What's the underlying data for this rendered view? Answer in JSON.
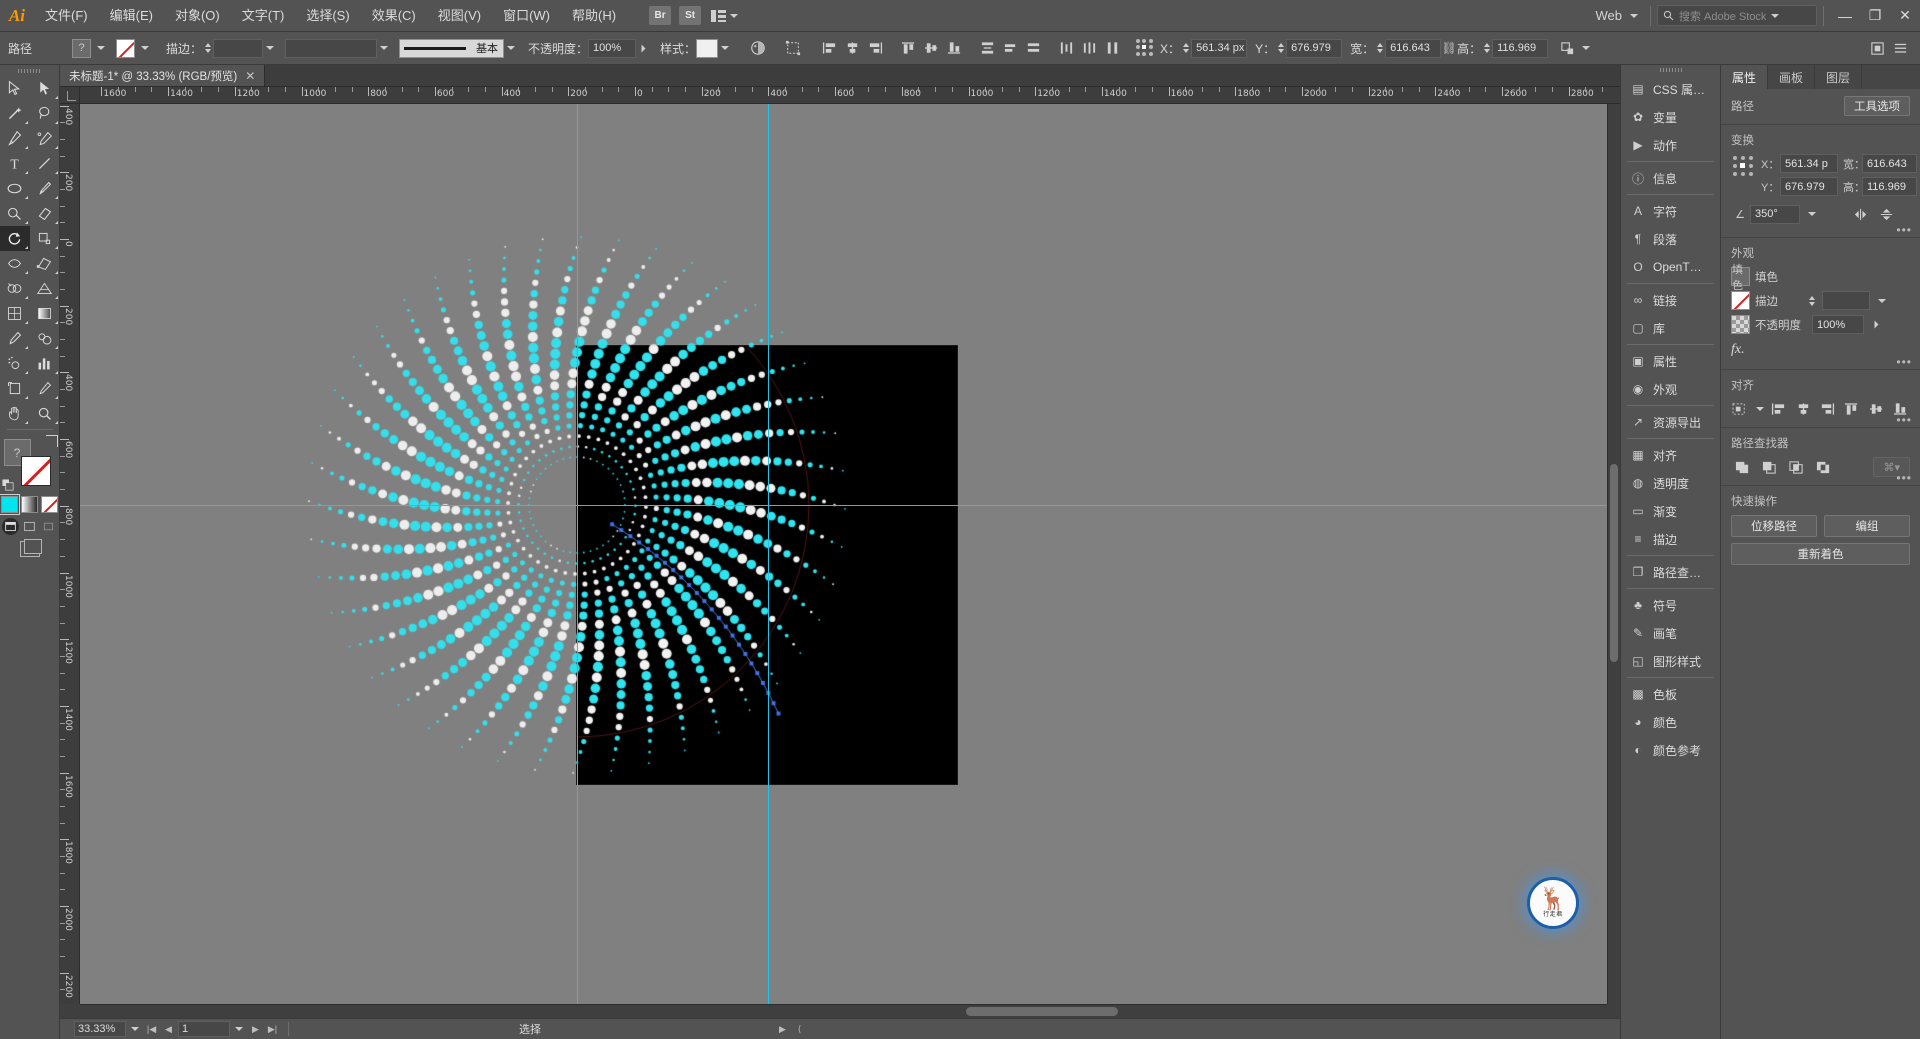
{
  "app": {
    "name": "Adobe Illustrator",
    "logo": "Ai"
  },
  "menubar": {
    "items": [
      "文件(F)",
      "编辑(E)",
      "对象(O)",
      "文字(T)",
      "选择(S)",
      "效果(C)",
      "视图(V)",
      "窗口(W)",
      "帮助(H)"
    ],
    "bridge_label": "Br",
    "stock_label": "St",
    "workspace_label": "Web",
    "search_placeholder": "搜索 Adobe Stock",
    "window_controls": {
      "minimize": "—",
      "restore": "❐",
      "close": "✕"
    }
  },
  "controlbar": {
    "object_label": "路径",
    "fill_label": "?",
    "stroke_label": "描边：",
    "stroke_weight": "",
    "brush_label": "基本",
    "opacity_label": "不透明度：",
    "opacity_value": "100%",
    "style_label": "样式：",
    "x_label": "X：",
    "x_value": "561.34 px",
    "y_label": "Y：",
    "y_value": "676.979",
    "w_label": "宽：",
    "w_value": "616.643",
    "h_label": "高：",
    "h_value": "116.969"
  },
  "toolbar": {
    "tools": [
      "selection-tool",
      "direct-selection-tool",
      "magic-wand-tool",
      "lasso-tool",
      "pen-tool",
      "curvature-tool",
      "type-tool",
      "line-segment-tool",
      "ellipse-tool",
      "paintbrush-tool",
      "shaper-tool",
      "eraser-tool",
      "rotate-tool",
      "scale-tool",
      "width-tool",
      "free-transform-tool",
      "shape-builder-tool",
      "perspective-grid-tool",
      "mesh-tool",
      "gradient-tool",
      "eyedropper-tool",
      "blend-tool",
      "symbol-sprayer-tool",
      "column-graph-tool",
      "artboard-tool",
      "slice-tool",
      "hand-tool",
      "zoom-tool"
    ],
    "selected_tool": "rotate-tool",
    "fill_label": "?",
    "color_modes": [
      "color-swatch",
      "gradient-swatch",
      "none-swatch"
    ],
    "screen_modes": [
      "normal-screen-mode",
      "full-screen-menubar",
      "full-screen"
    ],
    "fill_color": "#00e5ef"
  },
  "document": {
    "tab_title": "未标题-1* @ 33.33% (RGB/预览)",
    "close_label": "✕"
  },
  "rulers": {
    "horizontal": [
      "-600",
      "1400",
      "1200",
      "1000",
      "800",
      "600",
      "400",
      "200",
      "0",
      "200",
      "400",
      "600",
      "800",
      "1000",
      "1200",
      "1400",
      "1600",
      "1800",
      "2000",
      "2200",
      "2400",
      "2600"
    ],
    "vertical": [
      "800",
      "600",
      "400",
      "200",
      "0",
      "200",
      "400",
      "600",
      "800",
      "1000",
      "1200",
      "1400",
      "1600",
      "1800"
    ]
  },
  "artwork": {
    "description": "radial-dot-burst",
    "colors": {
      "background": "#000000",
      "dot_cyan": "#2fe3ef",
      "dot_white": "#f2f2f2",
      "accent_blue": "#3b6ce0"
    }
  },
  "statusbar": {
    "zoom_value": "33.33%",
    "page_value": "1",
    "tool_name": "选择"
  },
  "dock": {
    "groups": [
      [
        {
          "icon": "css-properties-icon",
          "label": "CSS 属…"
        },
        {
          "icon": "variables-icon",
          "label": "变量"
        },
        {
          "icon": "actions-icon",
          "label": "动作"
        }
      ],
      [
        {
          "icon": "info-icon",
          "label": "信息"
        }
      ],
      [
        {
          "icon": "character-icon",
          "label": "字符"
        },
        {
          "icon": "paragraph-icon",
          "label": "段落"
        },
        {
          "icon": "opentype-icon",
          "label": "OpenT…"
        }
      ],
      [
        {
          "icon": "links-icon",
          "label": "链接"
        },
        {
          "icon": "libraries-icon",
          "label": "库"
        }
      ],
      [
        {
          "icon": "properties-icon",
          "label": "属性"
        },
        {
          "icon": "appearance-icon",
          "label": "外观"
        }
      ],
      [
        {
          "icon": "asset-export-icon",
          "label": "资源导出"
        }
      ],
      [
        {
          "icon": "align-icon",
          "label": "对齐"
        },
        {
          "icon": "transparency-icon",
          "label": "透明度"
        },
        {
          "icon": "gradient-icon",
          "label": "渐变"
        },
        {
          "icon": "stroke-icon",
          "label": "描边"
        }
      ],
      [
        {
          "icon": "pathfinder-icon",
          "label": "路径查…"
        }
      ],
      [
        {
          "icon": "symbols-icon",
          "label": "符号"
        },
        {
          "icon": "brushes-icon",
          "label": "画笔"
        },
        {
          "icon": "graphic-styles-icon",
          "label": "图形样式"
        }
      ],
      [
        {
          "icon": "swatches-icon",
          "label": "色板"
        },
        {
          "icon": "color-icon",
          "label": "颜色"
        },
        {
          "icon": "color-guide-icon",
          "label": "颜色参考"
        }
      ]
    ]
  },
  "properties": {
    "tabs": [
      {
        "label": "属性",
        "active": true
      },
      {
        "label": "画板",
        "active": false
      },
      {
        "label": "图层",
        "active": false
      }
    ],
    "object_type": "路径",
    "tool_options_btn": "工具选项",
    "transform": {
      "title": "变换",
      "x_label": "X：",
      "x_value": "561.34 p",
      "y_label": "Y：",
      "y_value": "676.979",
      "w_label": "宽：",
      "w_value": "616.643",
      "h_label": "高：",
      "h_value": "116.969",
      "angle_value": "350°"
    },
    "appearance": {
      "title": "外观",
      "fill_label": "填色",
      "stroke_label": "描边",
      "stroke_weight": "",
      "opacity_label": "不透明度",
      "opacity_value": "100%",
      "fx_label": "fx."
    },
    "align": {
      "title": "对齐"
    },
    "pathfinder": {
      "title": "路径查找器"
    },
    "quick_actions": {
      "title": "快速操作",
      "offset_path": "位移路径",
      "group": "编组",
      "recolor": "重新着色"
    }
  },
  "watermark": {
    "glyph": "🦌",
    "text": "行走君"
  }
}
